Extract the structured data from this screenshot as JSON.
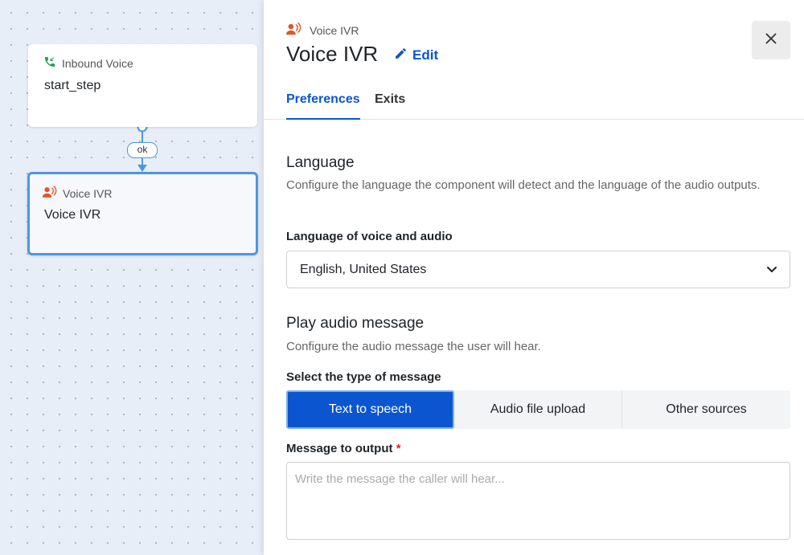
{
  "canvas": {
    "nodes": [
      {
        "type_label": "Inbound Voice",
        "title": "start_step"
      },
      {
        "type_label": "Voice IVR",
        "title": "Voice IVR"
      }
    ],
    "connector_label": "ok"
  },
  "panel": {
    "type_label": "Voice IVR",
    "title": "Voice IVR",
    "edit_label": "Edit",
    "close_label": "×",
    "tabs": [
      {
        "label": "Preferences",
        "active": true
      },
      {
        "label": "Exits",
        "active": false
      }
    ],
    "language": {
      "heading": "Language",
      "description": "Configure the language the component will detect and the language of the audio outputs.",
      "field_label": "Language of voice and audio",
      "selected": "English, United States"
    },
    "audio": {
      "heading": "Play audio message",
      "description": "Configure the audio message the user will hear.",
      "type_label": "Select the type of message",
      "options": [
        "Text to speech",
        "Audio file upload",
        "Other sources"
      ],
      "selected_option": "Text to speech",
      "message_label": "Message to output",
      "required_mark": "*",
      "message_placeholder": "Write the message the caller will hear...",
      "message_value": ""
    }
  },
  "colors": {
    "accent": "#0b55d0",
    "node_selected_border": "#4f97dd",
    "inbound_icon": "#1f9d55",
    "ivr_icon": "#e0562a",
    "canvas_bg": "#e8eef8"
  },
  "icons": {
    "inbound": "phone-incoming-icon",
    "ivr": "voice-speaker-icon",
    "edit": "pencil-icon",
    "close": "close-icon",
    "dropdown": "chevron-down-icon"
  }
}
